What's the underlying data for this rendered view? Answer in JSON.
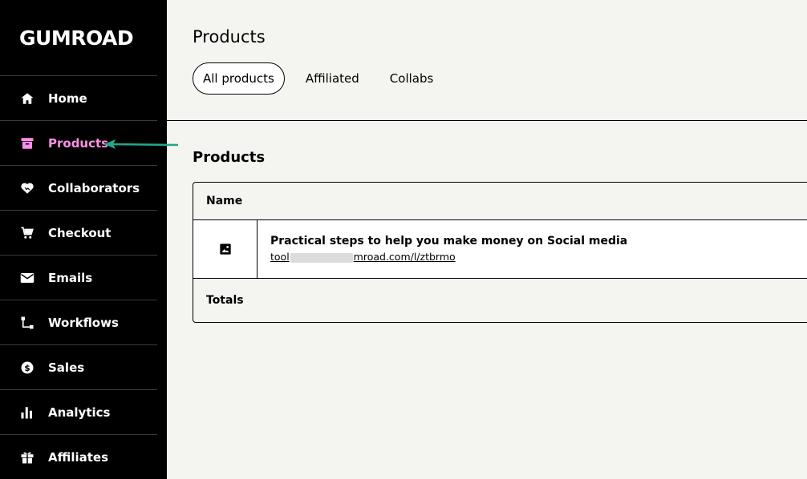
{
  "app": {
    "logo": "GUMROAD"
  },
  "sidebar": {
    "items": [
      {
        "label": "Home",
        "icon": "home-icon"
      },
      {
        "label": "Products",
        "icon": "archive-box-icon",
        "active": true
      },
      {
        "label": "Collaborators",
        "icon": "handshake-icon"
      },
      {
        "label": "Checkout",
        "icon": "cart-icon"
      },
      {
        "label": "Emails",
        "icon": "envelope-icon"
      },
      {
        "label": "Workflows",
        "icon": "workflow-icon"
      },
      {
        "label": "Sales",
        "icon": "dollar-circle-icon"
      },
      {
        "label": "Analytics",
        "icon": "bar-chart-icon"
      },
      {
        "label": "Affiliates",
        "icon": "gift-icon"
      }
    ]
  },
  "header": {
    "title": "Products",
    "tabs": [
      {
        "label": "All products",
        "active": true
      },
      {
        "label": "Affiliated"
      },
      {
        "label": "Collabs"
      }
    ]
  },
  "main": {
    "section_title": "Products",
    "table": {
      "header": "Name",
      "rows": [
        {
          "name": "Practical steps to help you make money on Social media",
          "url_prefix": "tool",
          "url_suffix": "mroad.com/l/ztbrmo"
        }
      ],
      "footer": "Totals"
    }
  },
  "colors": {
    "accent": "#ff90e8",
    "annotation": "#23a889",
    "sidebar_bg": "#000000",
    "page_bg": "#f4f4f0"
  }
}
